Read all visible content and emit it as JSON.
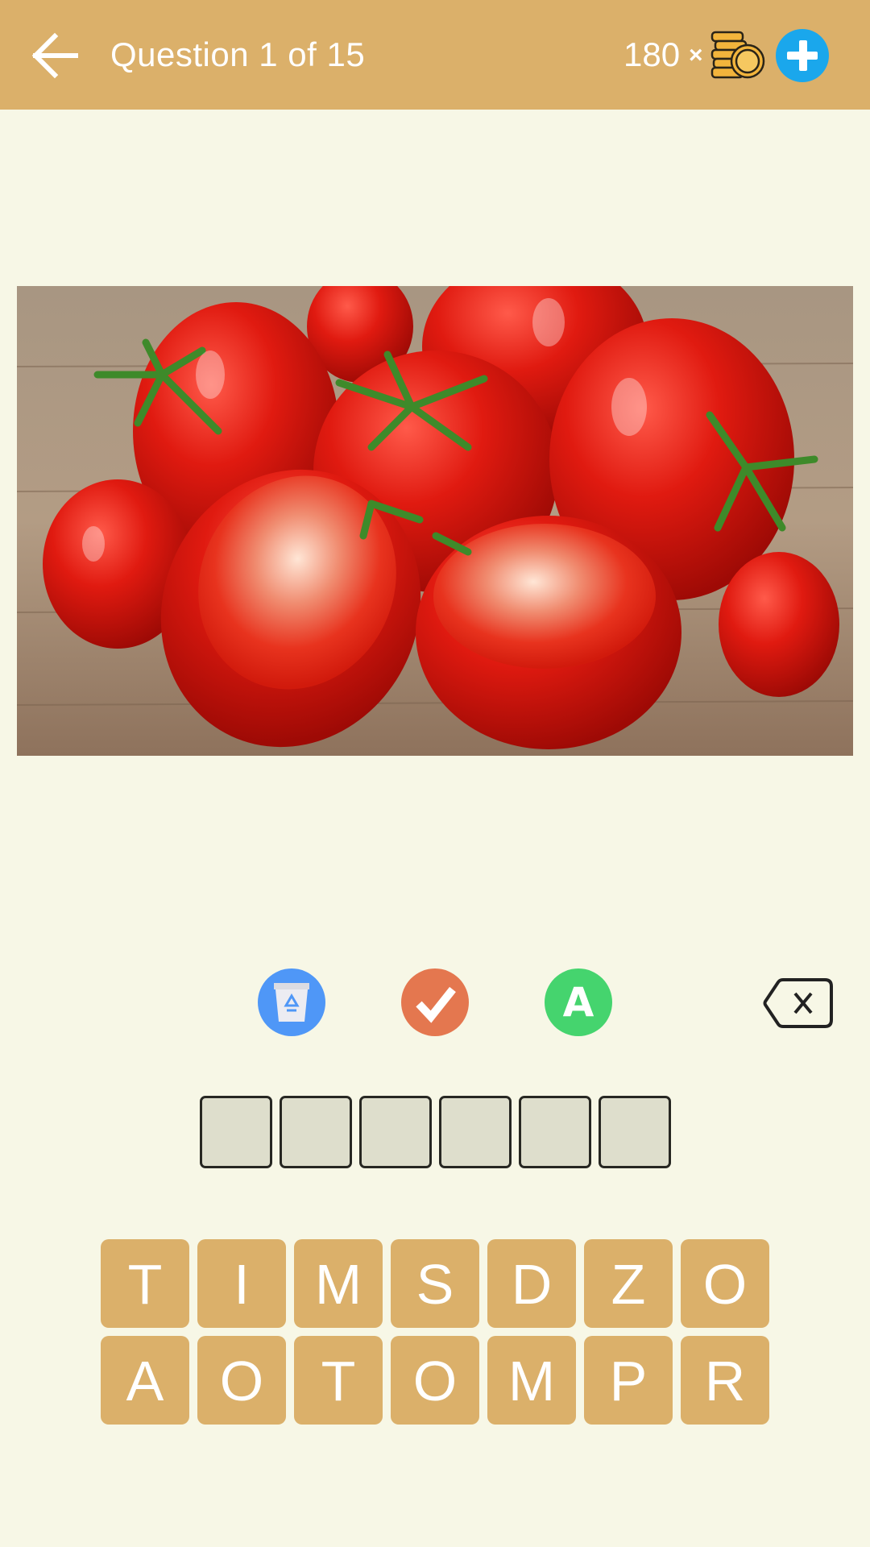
{
  "header": {
    "back_icon": "arrow-left-icon",
    "title": "Question 1 of 15",
    "coins": "180",
    "times_symbol": "×",
    "coin_icon": "coin-stack-icon",
    "add_icon": "plus-circle-icon",
    "background_color": "#DBB06A"
  },
  "question": {
    "image_description": "Photo of red tomatoes, whole and halved, on a wooden table"
  },
  "actions": [
    {
      "name": "remove-letters",
      "icon": "recycle-bin-icon",
      "color": "#4F97F7"
    },
    {
      "name": "reveal-letter",
      "icon": "checkmark-icon",
      "color": "#E4774F"
    },
    {
      "name": "show-answer",
      "icon": "letter-a-icon",
      "label": "A",
      "color": "#45D46E"
    },
    {
      "name": "backspace",
      "icon": "backspace-icon"
    }
  ],
  "answer": {
    "length": 6,
    "slots": [
      "",
      "",
      "",
      "",
      "",
      ""
    ]
  },
  "keyboard": {
    "rows": [
      [
        "T",
        "I",
        "M",
        "S",
        "D",
        "Z",
        "O"
      ],
      [
        "A",
        "O",
        "T",
        "O",
        "M",
        "P",
        "R"
      ]
    ]
  }
}
